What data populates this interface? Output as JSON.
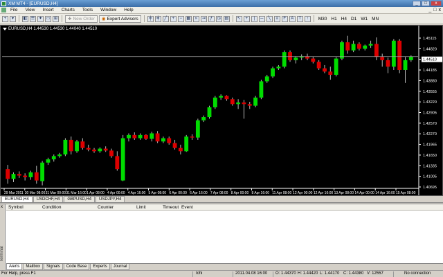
{
  "window": {
    "title": "XM MT4 - [EURUSD,H4]",
    "buttons": [
      "_",
      "□",
      "x"
    ]
  },
  "menu": {
    "items": [
      "File",
      "View",
      "Insert",
      "Charts",
      "Tools",
      "Window",
      "Help"
    ],
    "right_buttons": [
      "_",
      "□",
      "x"
    ]
  },
  "toolbar": {
    "new_order": "New Order",
    "expert_advisors": "Expert Advisors",
    "timeframes": [
      "M30",
      "H1",
      "H4",
      "D1",
      "W1",
      "MN"
    ]
  },
  "chart": {
    "info": "EURUSD,H4  1.44530 1.44530 1.44040 1.44510",
    "current_price": "1.44510",
    "price_labels": [
      "1.45115",
      "1.44820",
      "1.44510",
      "1.44185",
      "1.43880",
      "1.43555",
      "1.43220",
      "1.42905",
      "1.42570",
      "1.42270",
      "1.41965",
      "1.41650",
      "1.41335",
      "1.41005",
      "1.40695"
    ],
    "time_labels": [
      "29 Mar 2011",
      "30 Mar 08:00",
      "31 Mar 00:00",
      "31 Mar 16:00",
      "1 Apr 08:00",
      "4 Apr 00:00",
      "4 Apr 16:00",
      "5 Apr 08:00",
      "6 Apr 00:00",
      "6 Apr 16:00",
      "7 Apr 08:00",
      "8 Apr 00:00",
      "8 Apr 16:00",
      "11 Apr 08:00",
      "12 Apr 00:00",
      "12 Apr 16:00",
      "13 Apr 08:00",
      "14 Apr 00:00",
      "14 Apr 16:00",
      "15 Apr 08:00"
    ],
    "colors": {
      "bull": "#00dd00",
      "bear": "#dd0000",
      "background": "#000000",
      "text": "#ffffff",
      "price_line": "#a0a0a0"
    }
  },
  "chart_data": {
    "type": "candlestick",
    "symbol": "EURUSD",
    "timeframe": "H4",
    "ylim": [
      1.405,
      1.4525
    ],
    "candles": [
      {
        "o": 1.4105,
        "h": 1.4118,
        "l": 1.406,
        "c": 1.4075
      },
      {
        "o": 1.4075,
        "h": 1.4095,
        "l": 1.4065,
        "c": 1.409
      },
      {
        "o": 1.409,
        "h": 1.4098,
        "l": 1.4078,
        "c": 1.4085
      },
      {
        "o": 1.4085,
        "h": 1.4092,
        "l": 1.407,
        "c": 1.408
      },
      {
        "o": 1.408,
        "h": 1.41,
        "l": 1.4072,
        "c": 1.4095
      },
      {
        "o": 1.4095,
        "h": 1.4115,
        "l": 1.406,
        "c": 1.407
      },
      {
        "o": 1.4068,
        "h": 1.413,
        "l": 1.4055,
        "c": 1.4125
      },
      {
        "o": 1.4125,
        "h": 1.414,
        "l": 1.4118,
        "c": 1.4135
      },
      {
        "o": 1.4135,
        "h": 1.415,
        "l": 1.4128,
        "c": 1.4145
      },
      {
        "o": 1.4145,
        "h": 1.4155,
        "l": 1.414,
        "c": 1.415
      },
      {
        "o": 1.415,
        "h": 1.42,
        "l": 1.4145,
        "c": 1.4195
      },
      {
        "o": 1.4195,
        "h": 1.4205,
        "l": 1.415,
        "c": 1.416
      },
      {
        "o": 1.416,
        "h": 1.4195,
        "l": 1.4155,
        "c": 1.419
      },
      {
        "o": 1.419,
        "h": 1.42,
        "l": 1.4165,
        "c": 1.417
      },
      {
        "o": 1.417,
        "h": 1.418,
        "l": 1.416,
        "c": 1.4165
      },
      {
        "o": 1.4165,
        "h": 1.417,
        "l": 1.4155,
        "c": 1.416
      },
      {
        "o": 1.416,
        "h": 1.4172,
        "l": 1.4155,
        "c": 1.4168
      },
      {
        "o": 1.4168,
        "h": 1.4175,
        "l": 1.4158,
        "c": 1.4162
      },
      {
        "o": 1.4162,
        "h": 1.4168,
        "l": 1.414,
        "c": 1.4145
      },
      {
        "o": 1.4145,
        "h": 1.416,
        "l": 1.41,
        "c": 1.4105
      },
      {
        "o": 1.407,
        "h": 1.421,
        "l": 1.4068,
        "c": 1.42
      },
      {
        "o": 1.42,
        "h": 1.4215,
        "l": 1.419,
        "c": 1.421
      },
      {
        "o": 1.421,
        "h": 1.4218,
        "l": 1.4195,
        "c": 1.42
      },
      {
        "o": 1.42,
        "h": 1.4215,
        "l": 1.4195,
        "c": 1.421
      },
      {
        "o": 1.421,
        "h": 1.4212,
        "l": 1.4195,
        "c": 1.4198
      },
      {
        "o": 1.4198,
        "h": 1.422,
        "l": 1.419,
        "c": 1.4215
      },
      {
        "o": 1.4215,
        "h": 1.4222,
        "l": 1.4185,
        "c": 1.419
      },
      {
        "o": 1.419,
        "h": 1.4205,
        "l": 1.4185,
        "c": 1.42
      },
      {
        "o": 1.42,
        "h": 1.4205,
        "l": 1.418,
        "c": 1.4185
      },
      {
        "o": 1.4185,
        "h": 1.4195,
        "l": 1.4165,
        "c": 1.417
      },
      {
        "o": 1.417,
        "h": 1.418,
        "l": 1.415,
        "c": 1.416
      },
      {
        "o": 1.416,
        "h": 1.421,
        "l": 1.4158,
        "c": 1.4205
      },
      {
        "o": 1.4205,
        "h": 1.4212,
        "l": 1.4195,
        "c": 1.4202
      },
      {
        "o": 1.4202,
        "h": 1.426,
        "l": 1.4195,
        "c": 1.4255
      },
      {
        "o": 1.4255,
        "h": 1.427,
        "l": 1.425,
        "c": 1.4265
      },
      {
        "o": 1.4265,
        "h": 1.43,
        "l": 1.426,
        "c": 1.4295
      },
      {
        "o": 1.4295,
        "h": 1.433,
        "l": 1.429,
        "c": 1.4325
      },
      {
        "o": 1.4325,
        "h": 1.4335,
        "l": 1.4318,
        "c": 1.433
      },
      {
        "o": 1.433,
        "h": 1.4332,
        "l": 1.4315,
        "c": 1.432
      },
      {
        "o": 1.432,
        "h": 1.4325,
        "l": 1.43,
        "c": 1.4305
      },
      {
        "o": 1.4305,
        "h": 1.432,
        "l": 1.429,
        "c": 1.431
      },
      {
        "o": 1.431,
        "h": 1.4318,
        "l": 1.426,
        "c": 1.4305
      },
      {
        "o": 1.4305,
        "h": 1.4312,
        "l": 1.429,
        "c": 1.43
      },
      {
        "o": 1.43,
        "h": 1.433,
        "l": 1.4295,
        "c": 1.4325
      },
      {
        "o": 1.4325,
        "h": 1.438,
        "l": 1.432,
        "c": 1.4375
      },
      {
        "o": 1.4375,
        "h": 1.4395,
        "l": 1.437,
        "c": 1.439
      },
      {
        "o": 1.439,
        "h": 1.442,
        "l": 1.4385,
        "c": 1.4415
      },
      {
        "o": 1.4415,
        "h": 1.4425,
        "l": 1.441,
        "c": 1.442
      },
      {
        "o": 1.442,
        "h": 1.447,
        "l": 1.4415,
        "c": 1.4465
      },
      {
        "o": 1.4465,
        "h": 1.447,
        "l": 1.4435,
        "c": 1.444
      },
      {
        "o": 1.444,
        "h": 1.4452,
        "l": 1.443,
        "c": 1.4448
      },
      {
        "o": 1.4448,
        "h": 1.4458,
        "l": 1.444,
        "c": 1.4452
      },
      {
        "o": 1.4452,
        "h": 1.446,
        "l": 1.444,
        "c": 1.4445
      },
      {
        "o": 1.4445,
        "h": 1.445,
        "l": 1.443,
        "c": 1.4435
      },
      {
        "o": 1.4435,
        "h": 1.444,
        "l": 1.441,
        "c": 1.4415
      },
      {
        "o": 1.4415,
        "h": 1.4425,
        "l": 1.44,
        "c": 1.4405
      },
      {
        "o": 1.4405,
        "h": 1.442,
        "l": 1.438,
        "c": 1.4395
      },
      {
        "o": 1.4395,
        "h": 1.445,
        "l": 1.439,
        "c": 1.4445
      },
      {
        "o": 1.4445,
        "h": 1.45,
        "l": 1.444,
        "c": 1.4495
      },
      {
        "o": 1.4495,
        "h": 1.4515,
        "l": 1.446,
        "c": 1.447
      },
      {
        "o": 1.447,
        "h": 1.45,
        "l": 1.4465,
        "c": 1.449
      },
      {
        "o": 1.449,
        "h": 1.4495,
        "l": 1.447,
        "c": 1.4475
      },
      {
        "o": 1.4475,
        "h": 1.4488,
        "l": 1.447,
        "c": 1.4485
      },
      {
        "o": 1.4485,
        "h": 1.45,
        "l": 1.4478,
        "c": 1.449
      },
      {
        "o": 1.449,
        "h": 1.451,
        "l": 1.444,
        "c": 1.445
      },
      {
        "o": 1.445,
        "h": 1.446,
        "l": 1.442,
        "c": 1.444
      },
      {
        "o": 1.444,
        "h": 1.4448,
        "l": 1.44,
        "c": 1.442
      },
      {
        "o": 1.442,
        "h": 1.4505,
        "l": 1.441,
        "c": 1.45
      },
      {
        "o": 1.45,
        "h": 1.4505,
        "l": 1.44,
        "c": 1.441
      },
      {
        "o": 1.441,
        "h": 1.445,
        "l": 1.437,
        "c": 1.444
      },
      {
        "o": 1.444,
        "h": 1.4455,
        "l": 1.4435,
        "c": 1.4451
      }
    ]
  },
  "chart_tabs": [
    "EURUSD,H4",
    "USDCHF,H4",
    "GBPUSD,H4",
    "USDJPY,H4"
  ],
  "terminal": {
    "side_label": "Terminal",
    "close": "x",
    "columns": [
      "Symbol",
      "Condition",
      "Counter",
      "Limit",
      "Timeout",
      "Event"
    ],
    "tabs": [
      "Alerts",
      "Mailbox",
      "Signals",
      "Code Base",
      "Experts",
      "Journal"
    ]
  },
  "status": {
    "help": "For Help, press F1",
    "profile": "Ichi",
    "datetime": "2011.04.08 16:00",
    "open": "O: 1.44370",
    "high": "H: 1.44420",
    "low": "L: 1.44170",
    "close": "C: 1.44380",
    "volume": "V: 12557",
    "connection": "No connection"
  }
}
